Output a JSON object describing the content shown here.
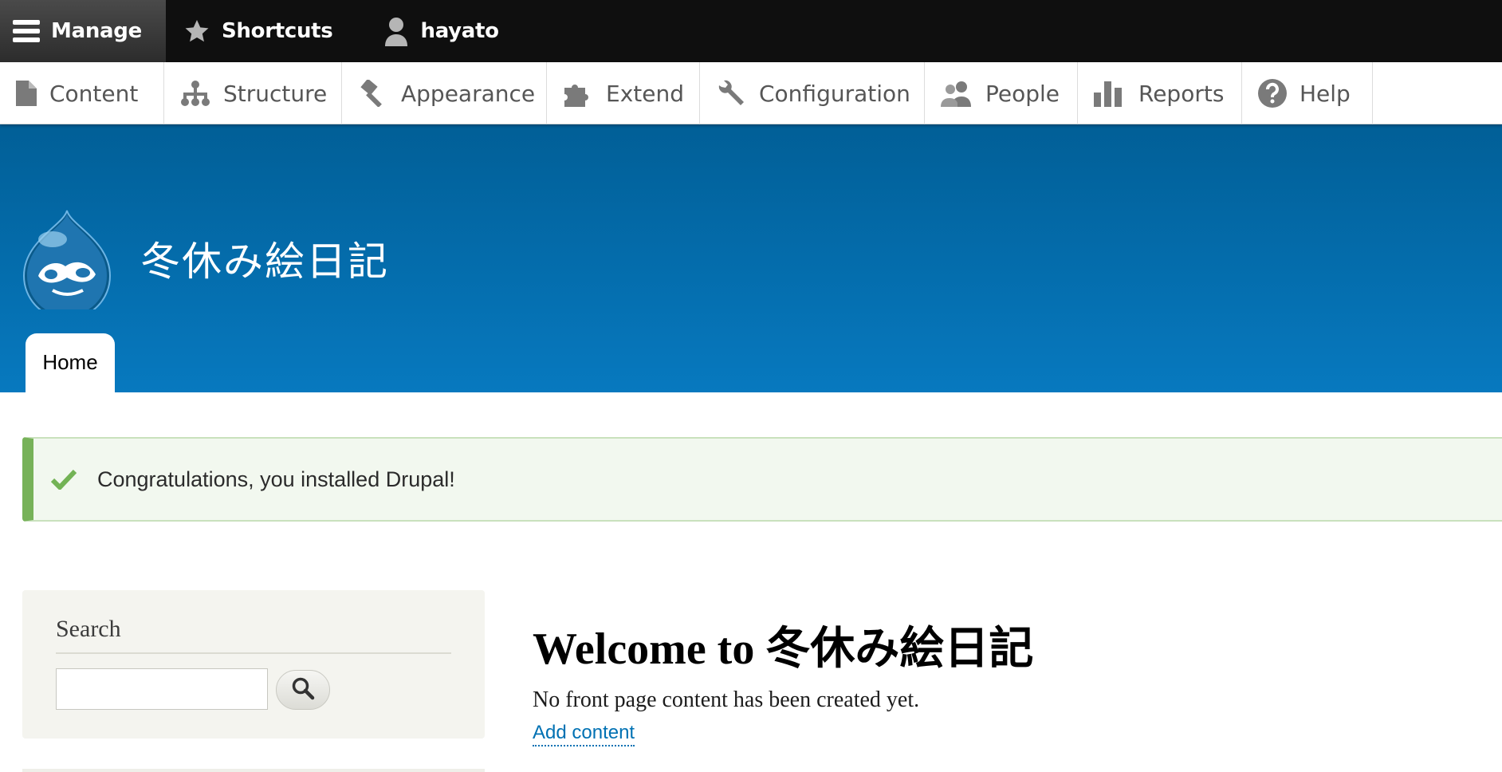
{
  "toolbar": {
    "manage_label": "Manage",
    "shortcuts_label": "Shortcuts",
    "user_label": "hayato"
  },
  "tray": {
    "items": [
      {
        "label": "Content",
        "icon": "file-icon"
      },
      {
        "label": "Structure",
        "icon": "sitemap-icon"
      },
      {
        "label": "Appearance",
        "icon": "paintbrush-icon"
      },
      {
        "label": "Extend",
        "icon": "puzzle-icon"
      },
      {
        "label": "Configuration",
        "icon": "wrench-icon"
      },
      {
        "label": "People",
        "icon": "people-icon"
      },
      {
        "label": "Reports",
        "icon": "bar-chart-icon"
      },
      {
        "label": "Help",
        "icon": "help-icon"
      }
    ]
  },
  "header": {
    "site_name": "冬休み絵日記",
    "nav_home": "Home"
  },
  "status": {
    "message": "Congratulations, you installed Drupal!"
  },
  "sidebar": {
    "search_title": "Search",
    "search_value": ""
  },
  "main": {
    "title": "Welcome to 冬休み絵日記",
    "body": "No front page content has been created yet.",
    "add_content_link": "Add content"
  },
  "colors": {
    "toolbar_bg": "#0f0f0f",
    "header_top": "#015f97",
    "header_bottom": "#0779bf",
    "status_accent": "#77b259",
    "link": "#0071b3"
  }
}
